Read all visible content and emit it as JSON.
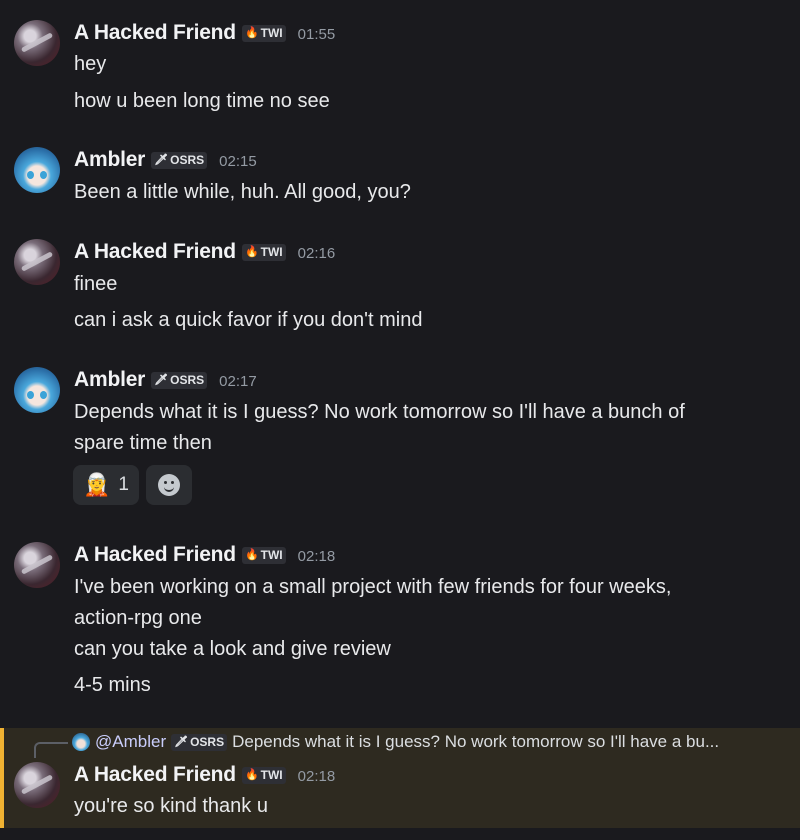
{
  "messages": [
    {
      "author": "A Hacked Friend",
      "tag_icon": "flame-icon",
      "tag_label": "TWI",
      "time": "01:55",
      "lines": [
        "hey",
        "how u been long time no see"
      ]
    },
    {
      "author": "Ambler",
      "tag_icon": "sword-icon",
      "tag_label": "OSRS",
      "time": "02:15",
      "lines": [
        "Been a little while, huh. All good, you?"
      ]
    },
    {
      "author": "A Hacked Friend",
      "tag_icon": "flame-icon",
      "tag_label": "TWI",
      "time": "02:16",
      "lines": [
        "finee",
        "can i ask a quick favor if you don't mind"
      ]
    },
    {
      "author": "Ambler",
      "tag_icon": "sword-icon",
      "tag_label": "OSRS",
      "time": "02:17",
      "lines": [
        "Depends what it is I guess? No work tomorrow so I'll have a bunch of",
        "spare time then"
      ],
      "reactions": [
        {
          "emoji": "person-emoji",
          "count": "1"
        }
      ]
    },
    {
      "author": "A Hacked Friend",
      "tag_icon": "flame-icon",
      "tag_label": "TWI",
      "time": "02:18",
      "lines": [
        "I've been working on a small project with few friends for four weeks,",
        "action-rpg one",
        "can you take a look and give review",
        "4-5 mins"
      ]
    },
    {
      "author": "A Hacked Friend",
      "tag_icon": "flame-icon",
      "tag_label": "TWI",
      "time": "02:18",
      "lines": [
        "you're so kind thank u"
      ],
      "reply": {
        "mention": "@Ambler",
        "tag_label": "OSRS",
        "preview": "Depends what it is I guess? No work tomorrow so I'll have a bu..."
      }
    }
  ],
  "colors": {
    "background": "#1a1a1e",
    "highlight_bar": "#f0b232",
    "highlight_bg": "#2e2a20"
  }
}
